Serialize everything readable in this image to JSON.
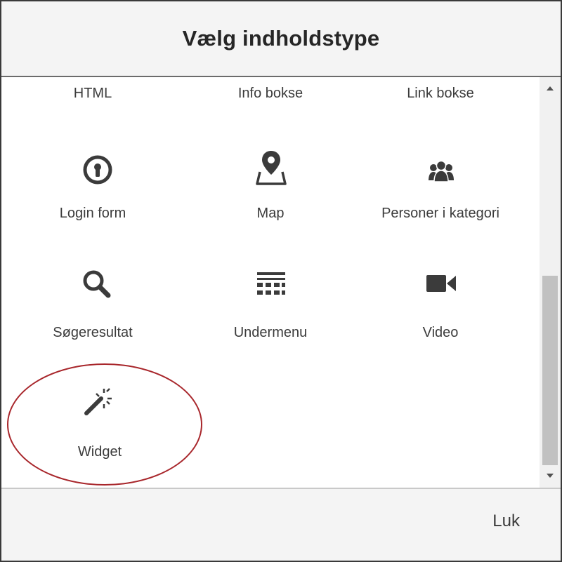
{
  "dialog": {
    "title": "Vælg indholdstype"
  },
  "items": {
    "html": {
      "label": "HTML"
    },
    "info_bokse": {
      "label": "Info bokse"
    },
    "link_bokse": {
      "label": "Link bokse"
    },
    "login_form": {
      "label": "Login form",
      "icon": "keyhole-icon"
    },
    "map": {
      "label": "Map",
      "icon": "map-pin-icon"
    },
    "personer": {
      "label": "Personer i kategori",
      "icon": "users-icon"
    },
    "sogeresultat": {
      "label": "Søgeresultat",
      "icon": "search-icon"
    },
    "undermenu": {
      "label": "Undermenu",
      "icon": "submenu-icon"
    },
    "video": {
      "label": "Video",
      "icon": "video-camera-icon"
    },
    "widget": {
      "label": "Widget",
      "icon": "magic-wand-icon"
    }
  },
  "footer": {
    "close_label": "Luk"
  },
  "colors": {
    "icon": "#3b3b3b",
    "highlight": "#a8262b",
    "header_bg": "#f4f4f4"
  }
}
